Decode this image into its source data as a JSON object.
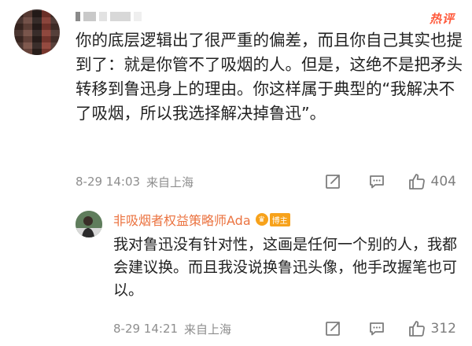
{
  "comment": {
    "hot_label": "热评",
    "text": "你的底层逻辑出了很严重的偏差，而且你自己其实也提到了：就是你管不了吸烟的人。但是，这绝不是把矛头转移到鲁迅身上的理由。你这样属于典型的“我解决不了吸烟，所以我选择解决掉鲁迅”。",
    "date": "8-29 14:03",
    "location": "来自上海",
    "like_count": "404"
  },
  "reply": {
    "author": "非吸烟者权益策略师Ada",
    "badge": "博主",
    "text": "我对鲁迅没有针对性，这画是任何一个别的人，我都会建议换。而且我没说换鲁迅头像，他手改握笔也可以。",
    "date": "8-29 14:21",
    "location": "来自上海",
    "like_count": "312"
  },
  "icons": [
    "share-icon",
    "comment-icon",
    "like-icon",
    "vip-crown-icon"
  ],
  "colors": {
    "hot_label": "#ff5a3c",
    "author_name": "#eb7340",
    "badge": "#f7a21b",
    "meta_text": "#8e8e8e"
  }
}
